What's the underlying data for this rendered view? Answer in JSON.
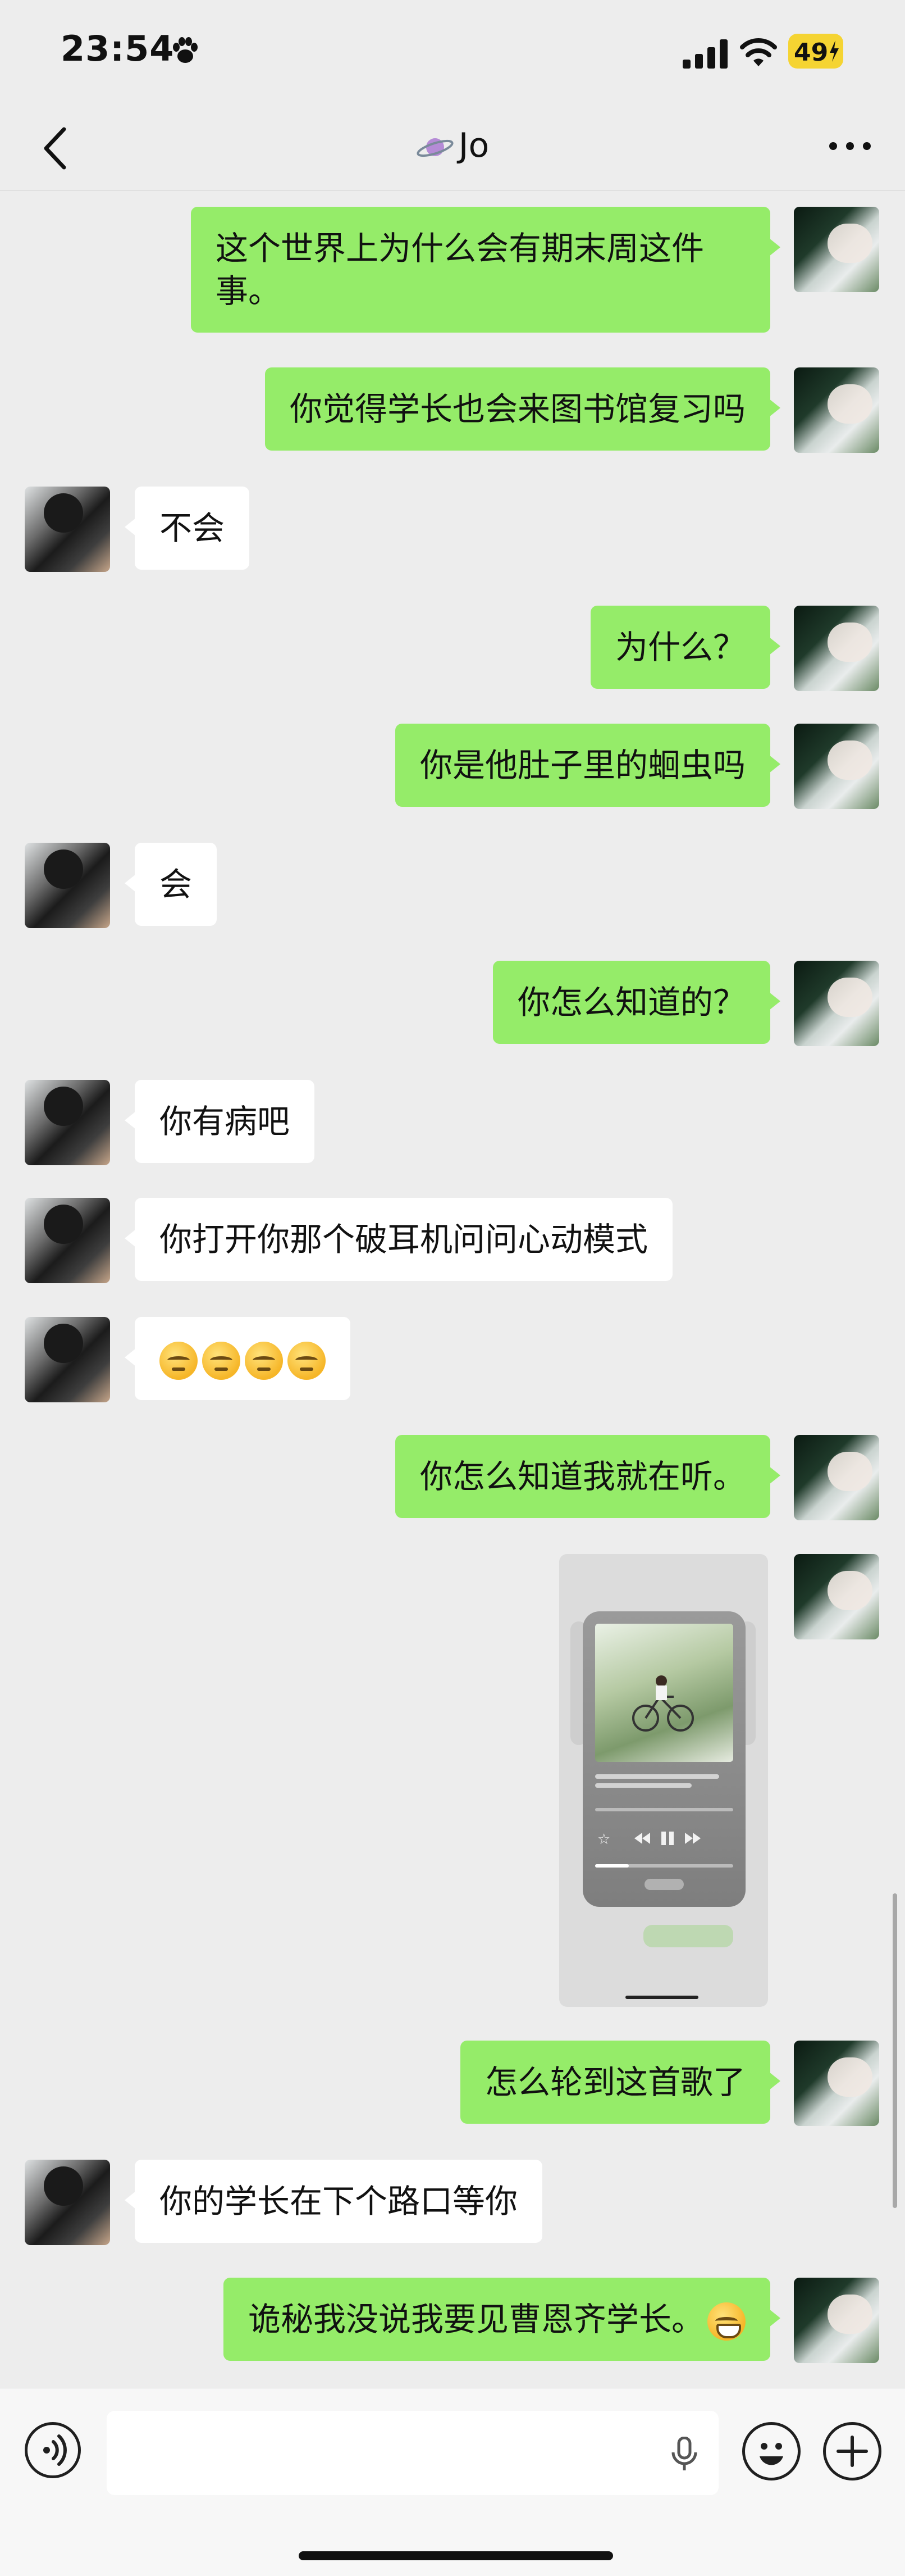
{
  "status_bar": {
    "time": "23:54",
    "battery": "49"
  },
  "header": {
    "title": "Jo"
  },
  "messages": [
    {
      "side": "me",
      "text": "这个世界上为什么会有期末周这件事。"
    },
    {
      "side": "me",
      "text": "你觉得学长也会来图书馆复习吗"
    },
    {
      "side": "them",
      "text": "不会"
    },
    {
      "side": "me",
      "text": "为什么？"
    },
    {
      "side": "me",
      "text": "你是他肚子里的蛔虫吗"
    },
    {
      "side": "them",
      "text": "会"
    },
    {
      "side": "me",
      "text": "你怎么知道的？"
    },
    {
      "side": "them",
      "text": "你有病吧"
    },
    {
      "side": "them",
      "text": "你打开你那个破耳机问问心动模式"
    },
    {
      "side": "them",
      "emoji_count": 4
    },
    {
      "side": "me",
      "text": "你怎么知道我就在听。"
    },
    {
      "side": "me",
      "type": "image"
    },
    {
      "side": "me",
      "text": "怎么轮到这首歌了"
    },
    {
      "side": "them",
      "text": "你的学长在下个路口等你"
    },
    {
      "side": "me",
      "text": "诡秘我没说我要见曹恩齐学长。"
    }
  ],
  "input": {
    "value": "",
    "placeholder": ""
  },
  "icons": {
    "back": "chevron-left-icon",
    "more": "more-dots-icon",
    "voice": "voice-mode-icon",
    "mic": "microphone-icon",
    "emoji": "emoji-icon",
    "plus": "plus-icon"
  },
  "colors": {
    "my_bubble": "#95ec69",
    "their_bubble": "#ffffff",
    "background": "#ededed",
    "battery": "#f5d432"
  }
}
